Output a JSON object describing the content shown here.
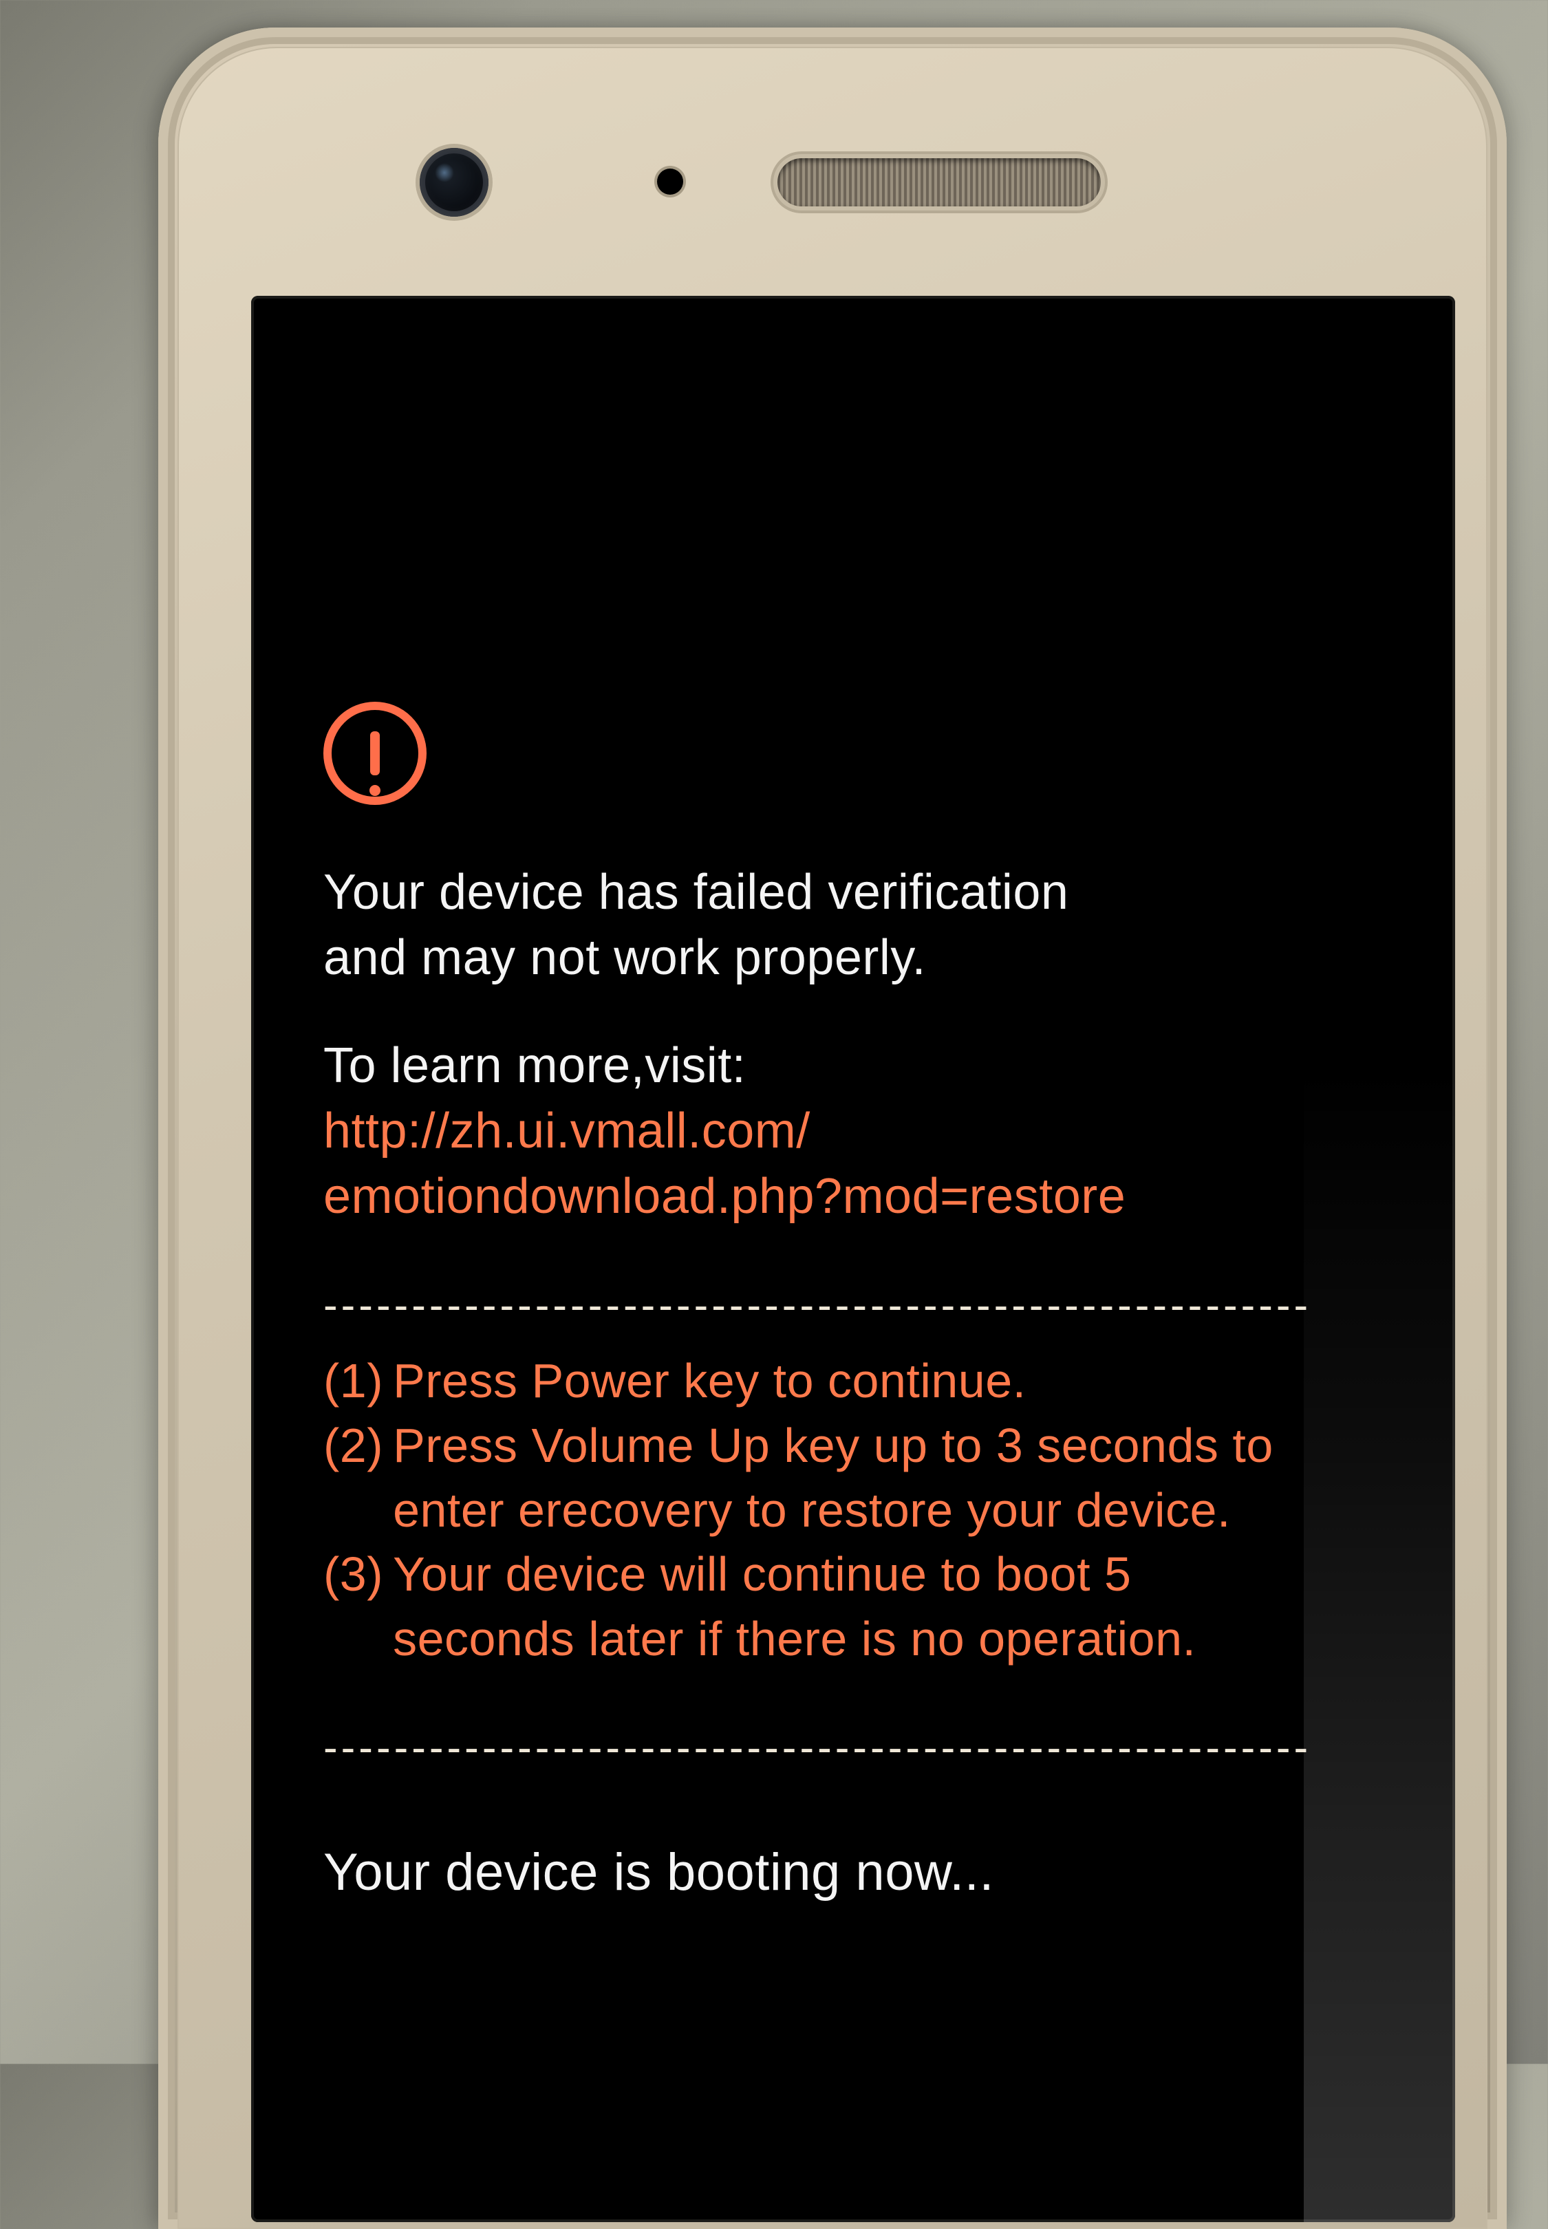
{
  "warning": {
    "line1": "Your device has failed verification",
    "line2": "and may not work properly."
  },
  "learn_more": {
    "prompt": "To learn more,visit:",
    "url_line1": "http://zh.ui.vmall.com/",
    "url_line2": "emotiondownload.php?mod=restore"
  },
  "separator": "--------------------------------------------------------",
  "options": {
    "n1": "(1)",
    "t1": "Press Power key to continue.",
    "n2": "(2)",
    "t2a": "Press Volume Up key up to 3 seconds to",
    "t2b": "enter erecovery to restore your device.",
    "n3": "(3)",
    "t3a": "Your device will continue to boot 5",
    "t3b": "seconds later if there is no operation."
  },
  "booting": "Your device is booting now..."
}
